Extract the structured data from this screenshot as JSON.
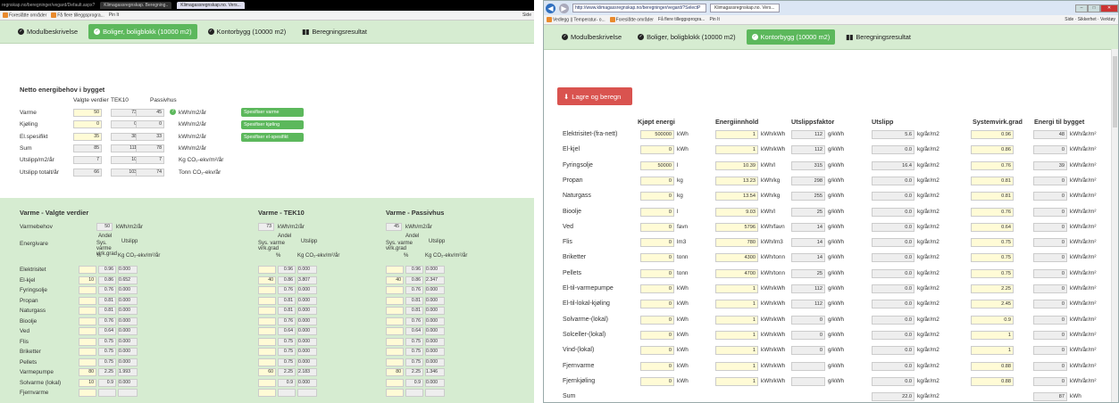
{
  "left": {
    "chrome": {
      "tabs": [
        "Klimagassregnskap. Beregning..",
        "Klimagassregnskap.no. Vers..."
      ],
      "address": "regnskap.no/beregninger/vegard/Default.aspx?",
      "fav": [
        "Foreslåtte områder",
        "Få flere tilleggsprogra...",
        "Pin It"
      ],
      "tools": "Side"
    },
    "tabs": [
      "Modulbeskrivelse",
      "Boliger, boligblokk (10000 m2)",
      "Kontorbygg (10000 m2)",
      "Beregningsresultat"
    ],
    "netto": {
      "title": "Netto energibehov i bygget",
      "cols": [
        "Valgte verdier",
        "TEK10",
        "Passivhus"
      ],
      "rows": [
        {
          "label": "Varme",
          "v": "50",
          "t": "73",
          "p": "45",
          "unit": "kWh/m2/år"
        },
        {
          "label": "Kjøling",
          "v": "0",
          "t": "0",
          "p": "0",
          "unit": "kWh/m2/år"
        },
        {
          "label": "El.spesifikt",
          "v": "35",
          "t": "38",
          "p": "33",
          "unit": "kWh/m2/år"
        },
        {
          "label": "Sum",
          "v": "85",
          "t": "111",
          "p": "78",
          "unit": "kWh/m2/år"
        },
        {
          "label": "Utslipp/m2/år",
          "v": "7",
          "t": "10",
          "p": "7",
          "unit": "Kg CO₂-ekv/m²/år"
        },
        {
          "label": "Utslipp totalt/år",
          "v": "66",
          "t": "103",
          "p": "74",
          "unit": "Tonn CO₂-ekv/år"
        }
      ],
      "buttons": [
        "Spesifiser varme",
        "Spesifiser kjøling",
        "Spesifiser el-spesifikt"
      ]
    },
    "varme": {
      "titles": [
        "Varme - Valgte verdier",
        "Varme - TEK10",
        "Varme - Passivhus"
      ],
      "behov_label": "Varmebehov",
      "behov": [
        "50",
        "73",
        "45"
      ],
      "behov_unit": "kWh/m2/år",
      "energivare": "Energivare",
      "h_andel": "Andel",
      "h_sys": "Sys. varme virk.grad",
      "h_utslipp": "Utslipp",
      "h_pct": "%",
      "h_unit": "Kg CO₂-ekv/m²/år",
      "rows": [
        {
          "n": "Elektrisitet",
          "a": [
            "",
            "",
            ""
          ],
          "s": [
            "0.96",
            "0.96",
            "0.96"
          ],
          "u": [
            "0.000",
            "0.000",
            "0.000"
          ]
        },
        {
          "n": "El-kjel",
          "a": [
            "10",
            "40",
            "40"
          ],
          "s": [
            "0.86",
            "0.86",
            "0.86"
          ],
          "u": [
            "0.652",
            "3.807",
            "2.347"
          ]
        },
        {
          "n": "Fyringsolje",
          "a": [
            "",
            "",
            ""
          ],
          "s": [
            "0.76",
            "0.76",
            "0.76"
          ],
          "u": [
            "0.000",
            "0.000",
            "0.000"
          ]
        },
        {
          "n": "Propan",
          "a": [
            "",
            "",
            ""
          ],
          "s": [
            "0.81",
            "0.81",
            "0.81"
          ],
          "u": [
            "0.000",
            "0.000",
            "0.000"
          ]
        },
        {
          "n": "Naturgass",
          "a": [
            "",
            "",
            ""
          ],
          "s": [
            "0.81",
            "0.81",
            "0.81"
          ],
          "u": [
            "0.000",
            "0.000",
            "0.000"
          ]
        },
        {
          "n": "Bioolje",
          "a": [
            "",
            "",
            ""
          ],
          "s": [
            "0.76",
            "0.76",
            "0.76"
          ],
          "u": [
            "0.000",
            "0.000",
            "0.000"
          ]
        },
        {
          "n": "Ved",
          "a": [
            "",
            "",
            ""
          ],
          "s": [
            "0.64",
            "0.64",
            "0.64"
          ],
          "u": [
            "0.000",
            "0.000",
            "0.000"
          ]
        },
        {
          "n": "Flis",
          "a": [
            "",
            "",
            ""
          ],
          "s": [
            "0.75",
            "0.75",
            "0.75"
          ],
          "u": [
            "0.000",
            "0.000",
            "0.000"
          ]
        },
        {
          "n": "Briketter",
          "a": [
            "",
            "",
            ""
          ],
          "s": [
            "0.75",
            "0.75",
            "0.75"
          ],
          "u": [
            "0.000",
            "0.000",
            "0.000"
          ]
        },
        {
          "n": "Pellets",
          "a": [
            "",
            "",
            ""
          ],
          "s": [
            "0.75",
            "0.75",
            "0.75"
          ],
          "u": [
            "0.000",
            "0.000",
            "0.000"
          ]
        },
        {
          "n": "Varmepumpe",
          "a": [
            "80",
            "60",
            "80"
          ],
          "s": [
            "2.25",
            "2.25",
            "2.25"
          ],
          "u": [
            "1.993",
            "2.183",
            "1.346"
          ]
        },
        {
          "n": "Solvarme (lokal)",
          "a": [
            "10",
            "",
            ""
          ],
          "s": [
            "0.9",
            "0.9",
            "0.9"
          ],
          "u": [
            "0.000",
            "0.000",
            "0.000"
          ]
        },
        {
          "n": "Fjernvarme",
          "a": [
            "",
            "",
            ""
          ],
          "s": [
            "",
            "",
            ""
          ],
          "u": [
            "",
            "",
            ""
          ]
        }
      ]
    }
  },
  "right": {
    "chrome": {
      "address": "http://www.klimagassregnskap.no/beregninger/vegard/?SelectP",
      "tab": "Klimagassregnskap.no. Vers...",
      "fav": [
        "Vedlegg || Temperatur- o...",
        "Foreslåtte områder",
        "Få flere tilleggsprogra...",
        "Pin It"
      ],
      "tools": [
        "Side",
        "Sikkerhet",
        "Verktøy"
      ]
    },
    "tabs": [
      "Modulbeskrivelse",
      "Boliger, boligblokk (10000 m2)",
      "Kontorbygg (10000 m2)",
      "Beregningsresultat"
    ],
    "save_label": "Lagre og beregn",
    "cols": [
      "Kjøpt energi",
      "Energiinnhold",
      "Utslippsfaktor",
      "Utslipp",
      "Systemvirk.grad",
      "Energi til bygget"
    ],
    "rows": [
      {
        "n": "Elektrisitet-(fra-nett)",
        "k": "500000",
        "ku": "kWh",
        "e": "1",
        "eu": "kWh/kWh",
        "f": "112",
        "fu": "g/kWh",
        "u": "5.6",
        "uu": "kg/år/m2",
        "s": "0.96",
        "b": "48",
        "bu": "kWh/år/m²"
      },
      {
        "n": "El-kjel",
        "k": "0",
        "ku": "kWh",
        "e": "1",
        "eu": "kWh/kWh",
        "f": "112",
        "fu": "g/kWh",
        "u": "0.0",
        "uu": "kg/år/m2",
        "s": "0.86",
        "b": "0",
        "bu": "kWh/år/m²"
      },
      {
        "n": "Fyringsolje",
        "k": "50000",
        "ku": "l",
        "e": "10.39",
        "eu": "kWh/l",
        "f": "315",
        "fu": "g/kWh",
        "u": "16.4",
        "uu": "kg/år/m2",
        "s": "0.76",
        "b": "39",
        "bu": "kWh/år/m²"
      },
      {
        "n": "Propan",
        "k": "0",
        "ku": "kg",
        "e": "13.23",
        "eu": "kWh/kg",
        "f": "298",
        "fu": "g/kWh",
        "u": "0.0",
        "uu": "kg/år/m2",
        "s": "0.81",
        "b": "0",
        "bu": "kWh/år/m²"
      },
      {
        "n": "Naturgass",
        "k": "0",
        "ku": "kg",
        "e": "13.54",
        "eu": "kWh/kg",
        "f": "255",
        "fu": "g/kWh",
        "u": "0.0",
        "uu": "kg/år/m2",
        "s": "0.81",
        "b": "0",
        "bu": "kWh/år/m²"
      },
      {
        "n": "Bioolje",
        "k": "0",
        "ku": "l",
        "e": "9.03",
        "eu": "kWh/l",
        "f": "25",
        "fu": "g/kWh",
        "u": "0.0",
        "uu": "kg/år/m2",
        "s": "0.76",
        "b": "0",
        "bu": "kWh/år/m²"
      },
      {
        "n": "Ved",
        "k": "0",
        "ku": "favn",
        "e": "5796",
        "eu": "kWh/favn",
        "f": "14",
        "fu": "g/kWh",
        "u": "0.0",
        "uu": "kg/år/m2",
        "s": "0.64",
        "b": "0",
        "bu": "kWh/år/m²"
      },
      {
        "n": "Flis",
        "k": "0",
        "ku": "lm3",
        "e": "780",
        "eu": "kWh/lm3",
        "f": "14",
        "fu": "g/kWh",
        "u": "0.0",
        "uu": "kg/år/m2",
        "s": "0.75",
        "b": "0",
        "bu": "kWh/år/m²"
      },
      {
        "n": "Briketter",
        "k": "0",
        "ku": "tonn",
        "e": "4300",
        "eu": "kWh/tonn",
        "f": "14",
        "fu": "g/kWh",
        "u": "0.0",
        "uu": "kg/år/m2",
        "s": "0.75",
        "b": "0",
        "bu": "kWh/år/m²"
      },
      {
        "n": "Pellets",
        "k": "0",
        "ku": "tonn",
        "e": "4700",
        "eu": "kWh/tonn",
        "f": "25",
        "fu": "g/kWh",
        "u": "0.0",
        "uu": "kg/år/m2",
        "s": "0.75",
        "b": "0",
        "bu": "kWh/år/m²"
      },
      {
        "n": "El-til-varmepumpe",
        "k": "0",
        "ku": "kWh",
        "e": "1",
        "eu": "kWh/kWh",
        "f": "112",
        "fu": "g/kWh",
        "u": "0.0",
        "uu": "kg/år/m2",
        "s": "2.25",
        "b": "0",
        "bu": "kWh/år/m²"
      },
      {
        "n": "El-til-lokal-kjøling",
        "k": "0",
        "ku": "kWh",
        "e": "1",
        "eu": "kWh/kWh",
        "f": "112",
        "fu": "g/kWh",
        "u": "0.0",
        "uu": "kg/år/m2",
        "s": "2.45",
        "b": "0",
        "bu": "kWh/år/m²"
      },
      {
        "n": "Solvarme-(lokal)",
        "k": "0",
        "ku": "kWh",
        "e": "1",
        "eu": "kWh/kWh",
        "f": "0",
        "fu": "g/kWh",
        "u": "0.0",
        "uu": "kg/år/m2",
        "s": "0.9",
        "b": "0",
        "bu": "kWh/år/m²"
      },
      {
        "n": "Solceller-(lokal)",
        "k": "0",
        "ku": "kWh",
        "e": "1",
        "eu": "kWh/kWh",
        "f": "0",
        "fu": "g/kWh",
        "u": "0.0",
        "uu": "kg/år/m2",
        "s": "1",
        "b": "0",
        "bu": "kWh/år/m²"
      },
      {
        "n": "Vind-(lokal)",
        "k": "0",
        "ku": "kWh",
        "e": "1",
        "eu": "kWh/kWh",
        "f": "0",
        "fu": "g/kWh",
        "u": "0.0",
        "uu": "kg/år/m2",
        "s": "1",
        "b": "0",
        "bu": "kWh/år/m²"
      },
      {
        "n": "Fjernvarme",
        "k": "0",
        "ku": "kWh",
        "e": "1",
        "eu": "kWh/kWh",
        "f": "",
        "fu": "g/kWh",
        "u": "0.0",
        "uu": "kg/år/m2",
        "s": "0.88",
        "b": "0",
        "bu": "kWh/år/m²"
      },
      {
        "n": "Fjernkjøling",
        "k": "0",
        "ku": "kWh",
        "e": "1",
        "eu": "kWh/kWh",
        "f": "",
        "fu": "g/kWh",
        "u": "0.0",
        "uu": "kg/år/m2",
        "s": "0.88",
        "b": "0",
        "bu": "kWh/år/m²"
      }
    ],
    "sum": {
      "label": "Sum",
      "u": "22.0",
      "uu": "kg/år/m2",
      "b": "87",
      "bu": "kWh"
    }
  }
}
